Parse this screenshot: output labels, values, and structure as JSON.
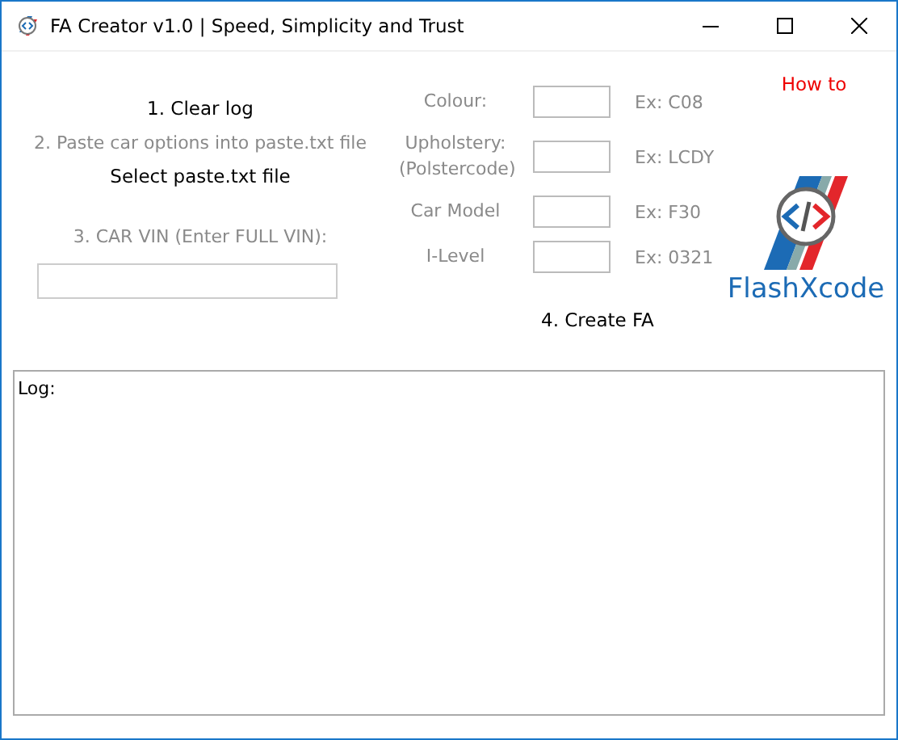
{
  "window": {
    "title": "FA Creator v1.0 | Speed, Simplicity and Trust"
  },
  "left": {
    "clear_button": "1. Clear log",
    "paste_label": "2. Paste car options into paste.txt file",
    "select_button": "Select paste.txt file",
    "vin_label": "3. CAR VIN (Enter FULL VIN):"
  },
  "fields": [
    {
      "label": "Colour:",
      "example": "Ex: C08"
    },
    {
      "label": "Upholstery:\n(Polstercode)",
      "example": "Ex: LCDY"
    },
    {
      "label": "Car Model",
      "example": "Ex: F30"
    },
    {
      "label": "I-Level",
      "example": "Ex: 0321"
    }
  ],
  "create_button": "4. Create FA",
  "how_to_link": "How to",
  "logo_text": "FlashXcode",
  "log_label": "Log:"
}
